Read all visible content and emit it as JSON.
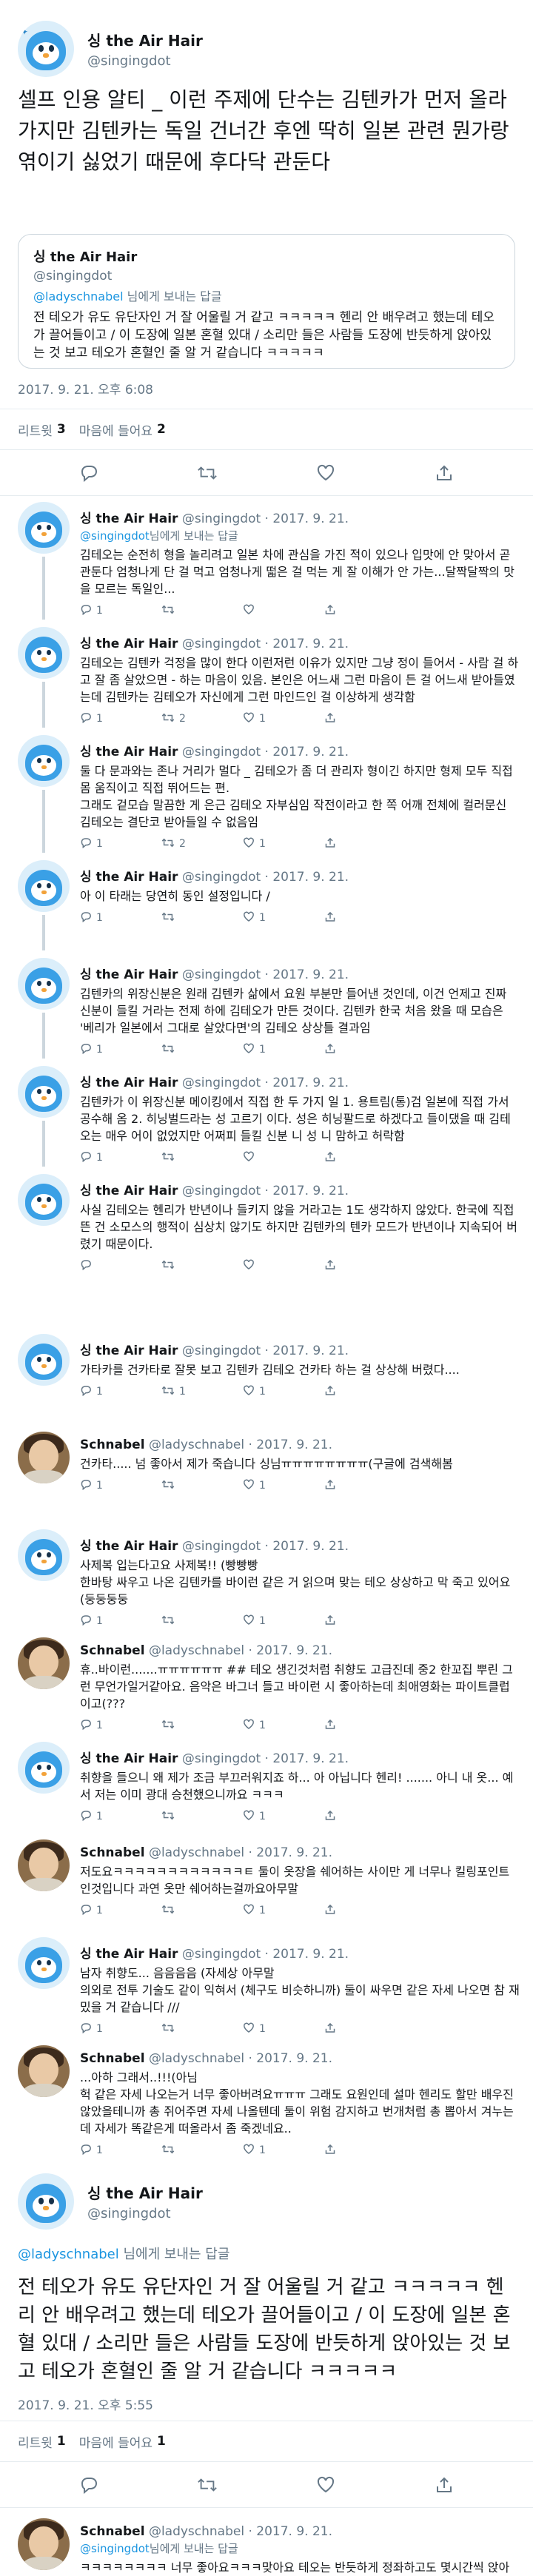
{
  "main_tweet": {
    "display_name": "싱 the Air Hair",
    "handle": "@singingdot",
    "text": "셀프 인용 알티 _ 이런 주제에 단수는 김텐카가 먼저 올라가지만 김텐카는 독일 건너간 후엔 딱히 일본 관련 뭔가랑 엮이기 싫었기 때문에 후다닥 관둔다",
    "quote": {
      "display_name": "싱 the Air Hair",
      "handle": "@singingdot",
      "reply_prefix": "",
      "reply_to": "@ladyschnabel",
      "reply_suffix": " 님에게 보내는 답글",
      "text": "전 테오가 유도 유단자인 거 잘 어울릴 거 같고 ㅋㅋㅋㅋㅋ 헨리 안 배우려고 했는데 테오가 끌어들이고 / 이 도장에 일본 혼혈 있대 / 소리만 들은 사람들 도장에 반듯하게 앉아있는 것 보고 테오가 혼혈인 줄 알 거 같습니다 ㅋㅋㅋㅋㅋ"
    },
    "timestamp": "2017. 9. 21. 오후 6:08",
    "retweets_label": "리트윗",
    "retweets": "3",
    "likes_label": "마음에 들어요",
    "likes": "2"
  },
  "action_icons": [
    "reply-icon",
    "retweet-icon",
    "heart-icon",
    "share-icon"
  ],
  "thread": [
    {
      "name": "싱 the Air Hair",
      "meta": "@singingdot · 2017. 9. 21.",
      "reply_to": "@singingdot",
      "reply_suffix": "님에게 보내는 답글",
      "text": "김테오는 순전히 형을 놀리려고 일본 차에 관심을 가진 적이 있으나 입맛에 안 맞아서 곧 관둔다 엄청나게 단 걸 먹고 엄청나게 떫은 걸 먹는 게 잘 이해가 안 가는...달짝달짝의 맛을 모르는 독일인...",
      "avatar": "bird",
      "replies": "1",
      "retweets": "",
      "likes": "",
      "line": true
    },
    {
      "name": "싱 the Air Hair",
      "meta": "@singingdot · 2017. 9. 21.",
      "reply_to": "",
      "reply_suffix": "",
      "text": "김테오는 김텐카 걱정을 많이 한다 이런저런 이유가 있지만 그냥 정이 들어서 - 사람 걸 하고 잘 좀 살았으면 - 하는 마음이 있음. 본인은 어느새 그런 마음이 든 걸 어느새 받아들였는데 김텐카는 김테오가 자신에게 그런 마인드인 걸 이상하게 생각함",
      "avatar": "bird",
      "replies": "1",
      "retweets": "2",
      "likes": "1",
      "line": true
    },
    {
      "name": "싱 the Air Hair",
      "meta": "@singingdot · 2017. 9. 21.",
      "reply_to": "",
      "reply_suffix": "",
      "text": "둘 다 문과와는 존나 거리가 멀다 _ 김테오가 좀 더 관리자 형이긴 하지만 형제 모두 직접 몸 움직이고 직접 뛰어드는 편.\n그래도 겉모습 말끔한 게 은근 김테오 자부심임 작전이라고 한 쪽 어깨 전체에 컬러문신 김테오는 결단코 받아들일 수 없음임",
      "avatar": "bird",
      "replies": "1",
      "retweets": "2",
      "likes": "1",
      "line": true
    },
    {
      "name": "싱 the Air Hair",
      "meta": "@singingdot · 2017. 9. 21.",
      "reply_to": "",
      "reply_suffix": "",
      "text": "아 이 타래는 당연히 동인 설정입니다 /",
      "avatar": "bird",
      "replies": "1",
      "retweets": "",
      "likes": "1",
      "line": true
    },
    {
      "name": "싱 the Air Hair",
      "meta": "@singingdot · 2017. 9. 21.",
      "reply_to": "",
      "reply_suffix": "",
      "text": "김텐카의 위장신분은 원래 김텐카 삶에서 요원 부분만 들어낸 것인데, 이건 언제고 진짜 신분이 들킬 거라는 전제 하에 김테오가 만든 것이다. 김텐카 한국 처음 왔을 때 모습은 '베리가 일본에서 그대로 살았다면'의 김테오 상상틀 결과임",
      "avatar": "bird",
      "replies": "1",
      "retweets": "",
      "likes": "1",
      "line": true
    },
    {
      "name": "싱 the Air Hair",
      "meta": "@singingdot · 2017. 9. 21.",
      "reply_to": "",
      "reply_suffix": "",
      "text": "김텐카가 이 위장신분 메이킹에서 직접 한 두 가지 일 1. 용트림(통)검 일본에 직접 가서 공수해 옴 2. 히닝벌드라는 성 고르기 이다. 성은 히닝팔드로 하겠다고 들이댔을 때 김테오는 매우 어이 없었지만 어쩌피 들킬 신분 니 성 니 맘하고 허락함",
      "avatar": "bird",
      "replies": "1",
      "retweets": "",
      "likes": "",
      "line": true
    },
    {
      "name": "싱 the Air Hair",
      "meta": "@singingdot · 2017. 9. 21.",
      "reply_to": "",
      "reply_suffix": "",
      "text": "사실 김테오는 헨리가 반년이나 들키지 않을 거라고는 1도 생각하지 않았다. 한국에 직접 뜬 건 소모스의 행적이 심상치 않기도 하지만 김텐카의 텐카 모드가 반년이나 지속되어 버렸기 때문이다.",
      "avatar": "bird",
      "replies": "",
      "retweets": "",
      "likes": "",
      "line": false
    }
  ],
  "thread2": [
    {
      "name": "싱 the Air Hair",
      "meta": "@singingdot · 2017. 9. 21.",
      "text": "가타카를 건카타로 잘못 보고 김텐카 김테오 건카타 하는 걸 상상해 버렸다....",
      "avatar": "bird",
      "replies": "1",
      "retweets": "1",
      "likes": "1"
    },
    {
      "name": "Schnabel",
      "meta": "@ladyschnabel · 2017. 9. 21.",
      "text": "건카타..... 넘 좋아서 제가 죽습니다 싱님ㅠㅠㅠㅠㅠㅠㅠㅠ(구글에 검색해봄",
      "avatar": "photo",
      "replies": "1",
      "retweets": "",
      "likes": "1"
    },
    {
      "name": "싱 the Air Hair",
      "meta": "@singingdot · 2017. 9. 21.",
      "text": "사제복 입는다고요 사제복!! (빵빵빵\n한바탕 싸우고 나온 김텐카를 바이런 같은 거 읽으며 맞는 테오 상상하고 막 죽고 있어요 (둥둥둥둥",
      "avatar": "bird",
      "replies": "1",
      "retweets": "",
      "likes": "1"
    },
    {
      "name": "Schnabel",
      "meta": "@ladyschnabel · 2017. 9. 21.",
      "text": "휴..바이런.......ㅠㅠㅠㅠㅠㅠ ## 테오 생긴것처럼 취향도 고급진데 중2 한꼬집 뿌린 그런 무언가일거같아요. 음악은 바그너 들고 바이런 시 좋아하는데 최애영화는 파이트클럽이고(???",
      "avatar": "photo",
      "replies": "1",
      "retweets": "",
      "likes": "1"
    },
    {
      "name": "싱 the Air Hair",
      "meta": "@singingdot · 2017. 9. 21.",
      "text": "취향을 들으니 왜 제가 조금 부끄러워지죠 하... 아 아닙니다 헨리! ....... 아니 내 옷... 예서 저는 이미 광대 승천했으니까요 ㅋㅋㅋ",
      "avatar": "bird",
      "replies": "1",
      "retweets": "",
      "likes": "1"
    },
    {
      "name": "Schnabel",
      "meta": "@ladyschnabel · 2017. 9. 21.",
      "text": "저도요ㅋㅋㅋㅋㅋㅋㅋㅋㅋㅋㅋㅋㅌ 둘이 옷장을 쉐어하는 사이만 게 너무나 킬링포인트인것입니다 과연 옷만 쉐어하는걸까요아무말",
      "avatar": "photo",
      "replies": "1",
      "retweets": "",
      "likes": "1"
    },
    {
      "name": "싱 the Air Hair",
      "meta": "@singingdot · 2017. 9. 21.",
      "text": "남자 취향도... 음음음음 (자세상 아무말\n의외로 전투 기술도 같이 익혀서 (체구도 비슷하니까) 둘이 싸우면 같은 자세 나오면 참 재밌을 거 같습니다 ///",
      "avatar": "bird",
      "replies": "1",
      "retweets": "",
      "likes": "1"
    },
    {
      "name": "Schnabel",
      "meta": "@ladyschnabel · 2017. 9. 21.",
      "text": "...아하 그래서..!!!(아님\n헉 같은 자세 나오는거 너무 좋아버려요ㅠㅠㅠ 그래도 요원인데 설마 헨리도 할만 배우진 않았을테니까 총 쥐어주면 자세 나올텐데 둘이 위험 감지하고 번개처럼 총 뽑아서 겨누는데 자세가 똑같은게 떠올라서 좀 죽겠네요..",
      "avatar": "photo",
      "replies": "1",
      "retweets": "",
      "likes": "1"
    }
  ],
  "final_tweet": {
    "display_name": "싱 the Air Hair",
    "handle": "@singingdot",
    "reply_to": "@ladyschnabel",
    "reply_suffix": " 님에게 보내는 답글",
    "text": "전 테오가 유도 유단자인 거 잘 어울릴 거 같고 ㅋㅋㅋㅋㅋ 헨리 안 배우려고 했는데 테오가 끌어들이고 / 이 도장에 일본 혼혈 있대 / 소리만 들은 사람들 도장에 반듯하게 앉아있는 것 보고 테오가 혼혈인 줄 알 거 같습니다 ㅋㅋㅋㅋㅋ",
    "timestamp": "2017. 9. 21. 오후 5:55",
    "retweets_label": "리트윗",
    "retweets": "1",
    "likes_label": "마음에 들어요",
    "likes": "1"
  },
  "last_reply": {
    "name": "Schnabel",
    "meta": "@ladyschnabel · 2017. 9. 21.",
    "reply_to": "@singingdot",
    "reply_suffix": "님에게 보내는 답글",
    "text": "ㅋㅋㅋㅋㅋㅋㅋㅋ 너무 좋아요ㅋㅋㅋ맞아요 테오는 반듯하게 정좌하고도 몇시간씩 앉아있는데 헨리는 집중력도 개판이고 자세도 이상하고 다리 저리다고 찡찡댈거같아요ㅋㅋㅋ 테오가 도장에 꼴고가서 같이 유도 배우는 애들 넘 좋네여.."
  }
}
